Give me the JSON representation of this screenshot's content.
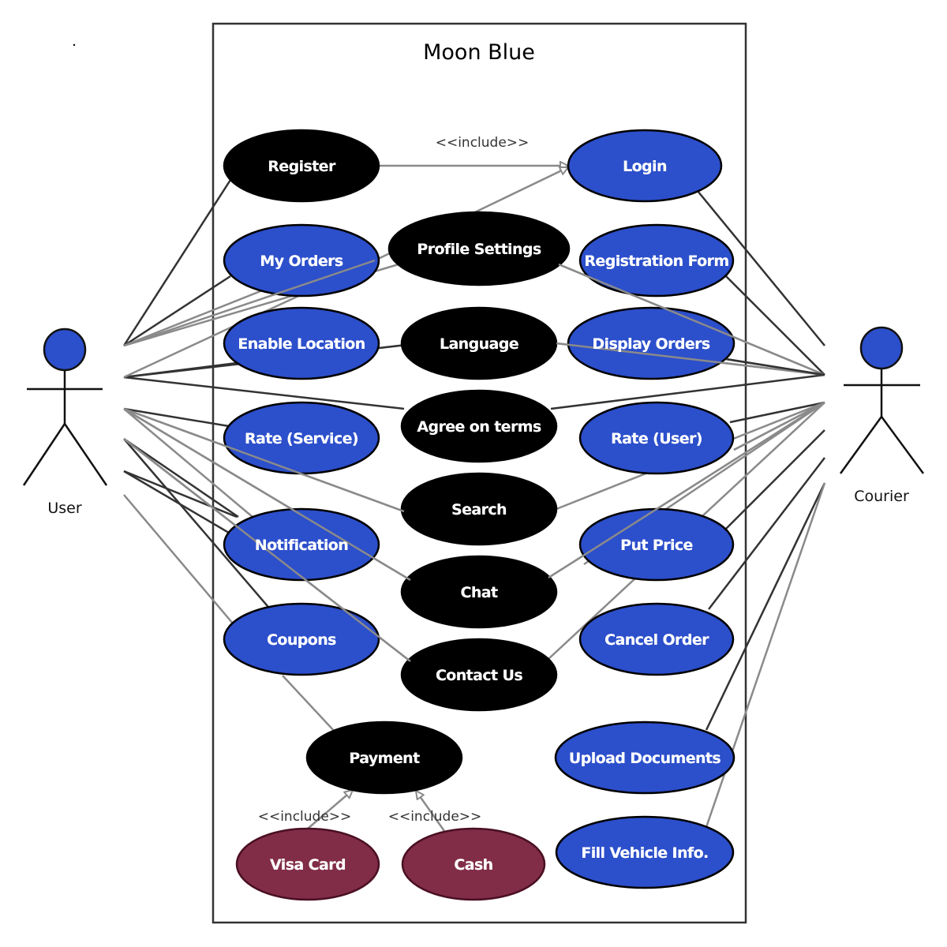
{
  "system": {
    "title": "Moon Blue"
  },
  "colors": {
    "blue": "#2c4fcb",
    "black": "#000000",
    "maroon": "#812d48",
    "dark_line": "#333333",
    "gray_line": "#8a8a8a"
  },
  "actors": [
    {
      "id": "user",
      "label": "User"
    },
    {
      "id": "courier",
      "label": "Courier"
    }
  ],
  "use_cases": [
    {
      "id": "register",
      "label": "Register",
      "color": "black"
    },
    {
      "id": "login",
      "label": "Login",
      "color": "blue"
    },
    {
      "id": "my_orders",
      "label": "My Orders",
      "color": "blue"
    },
    {
      "id": "profile_settings",
      "label": "Profile Settings",
      "color": "black"
    },
    {
      "id": "registration_form",
      "label": "Registration Form",
      "color": "blue"
    },
    {
      "id": "enable_location",
      "label": "Enable Location",
      "color": "blue"
    },
    {
      "id": "language",
      "label": "Language",
      "color": "black"
    },
    {
      "id": "display_orders",
      "label": "Display Orders",
      "color": "blue"
    },
    {
      "id": "agree_terms",
      "label": "Agree on terms",
      "color": "black"
    },
    {
      "id": "rate_service",
      "label": "Rate (Service)",
      "color": "blue"
    },
    {
      "id": "rate_user",
      "label": "Rate (User)",
      "color": "blue"
    },
    {
      "id": "search",
      "label": "Search",
      "color": "black"
    },
    {
      "id": "notification",
      "label": "Notification",
      "color": "blue"
    },
    {
      "id": "put_price",
      "label": "Put Price",
      "color": "blue"
    },
    {
      "id": "chat",
      "label": "Chat",
      "color": "black"
    },
    {
      "id": "coupons",
      "label": "Coupons",
      "color": "blue"
    },
    {
      "id": "cancel_order",
      "label": "Cancel Order",
      "color": "blue"
    },
    {
      "id": "contact_us",
      "label": "Contact Us",
      "color": "black"
    },
    {
      "id": "payment",
      "label": "Payment",
      "color": "black"
    },
    {
      "id": "upload_documents",
      "label": "Upload Documents",
      "color": "blue"
    },
    {
      "id": "visa_card",
      "label": "Visa Card",
      "color": "maroon"
    },
    {
      "id": "cash",
      "label": "Cash",
      "color": "maroon"
    },
    {
      "id": "fill_vehicle",
      "label": "Fill Vehicle Info.",
      "color": "blue"
    }
  ],
  "relations": [
    {
      "from": "register",
      "to": "login",
      "type": "include",
      "label": "<<include>>"
    },
    {
      "from": "visa_card",
      "to": "payment",
      "type": "include",
      "label": "<<include>>"
    },
    {
      "from": "cash",
      "to": "payment",
      "type": "include",
      "label": "<<include>>"
    },
    {
      "from": "my_orders",
      "to": "login",
      "type": "include",
      "label": ""
    },
    {
      "from": "coupons",
      "to": "payment",
      "type": "association",
      "label": ""
    }
  ],
  "associations": {
    "user": [
      "register",
      "my_orders",
      "profile_settings",
      "enable_location",
      "language",
      "agree_terms",
      "rate_service",
      "search",
      "notification",
      "chat",
      "contact_us",
      "coupons"
    ],
    "courier": [
      "login",
      "profile_settings",
      "registration_form",
      "language",
      "display_orders",
      "agree_terms",
      "rate_user",
      "search",
      "put_price",
      "chat",
      "contact_us",
      "cancel_order",
      "upload_documents",
      "fill_vehicle"
    ]
  }
}
